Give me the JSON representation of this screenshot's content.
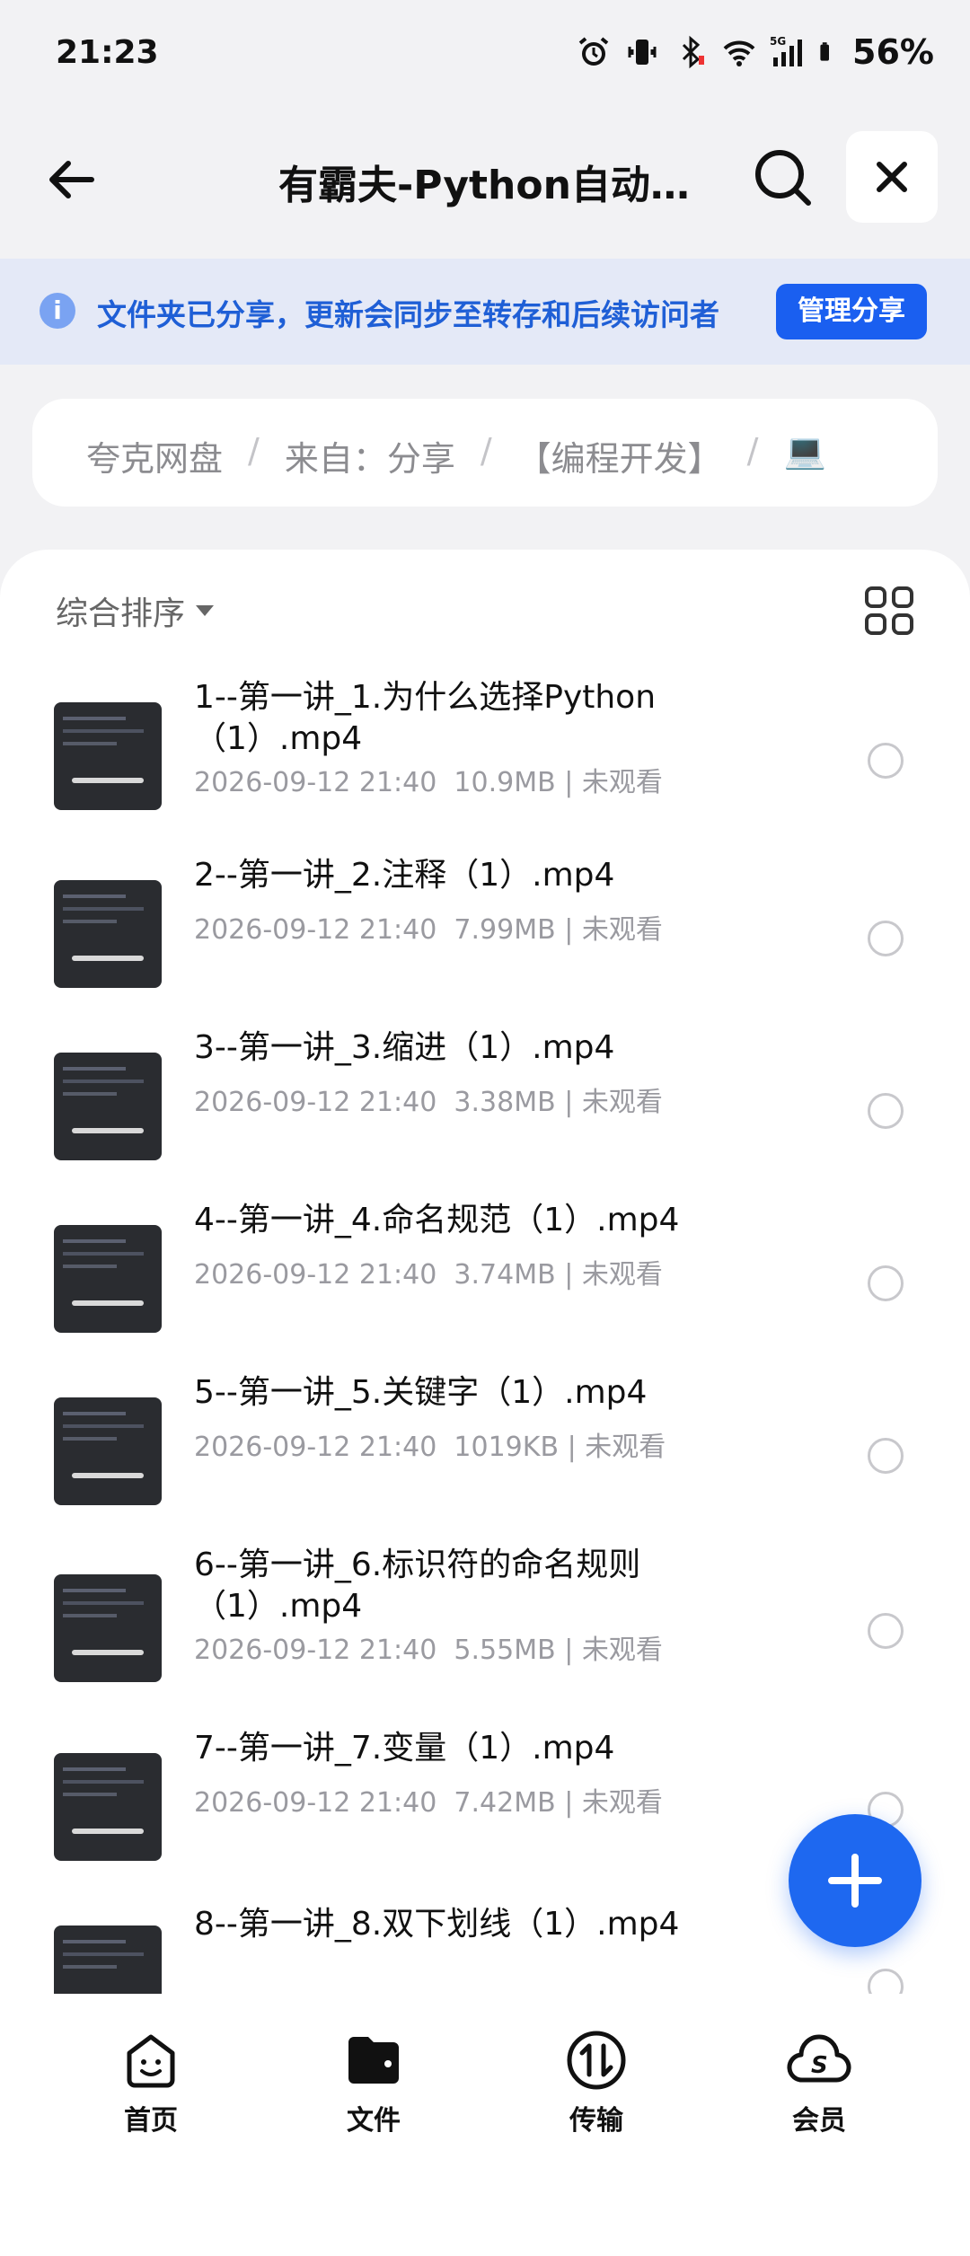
{
  "status": {
    "time": "21:23",
    "battery": "56%",
    "network": "5G",
    "icons": [
      "alarm-icon",
      "vibrate-icon",
      "bluetooth-icon",
      "wifi-icon",
      "signal-icon",
      "battery-icon"
    ]
  },
  "header": {
    "title": "有霸夫-Python自动...",
    "icons": [
      "back-arrow-icon",
      "search-icon",
      "close-icon"
    ]
  },
  "banner": {
    "text": "文件夹已分享，更新会同步至转存和后续访问者",
    "button": "管理分享"
  },
  "breadcrumb": {
    "items": [
      "夸克网盘",
      "来自：分享",
      "【编程开发】",
      "💻"
    ],
    "separator": "/"
  },
  "toolbar": {
    "sort_label": "综合排序"
  },
  "files": [
    {
      "name": "1--第一讲_1.为什么选择Python（1）.mp4",
      "date": "2026-09-12 21:40",
      "size": "10.9MB",
      "status": "未观看"
    },
    {
      "name": "2--第一讲_2.注释（1）.mp4",
      "date": "2026-09-12 21:40",
      "size": "7.99MB",
      "status": "未观看"
    },
    {
      "name": "3--第一讲_3.缩进（1）.mp4",
      "date": "2026-09-12 21:40",
      "size": "3.38MB",
      "status": "未观看"
    },
    {
      "name": "4--第一讲_4.命名规范（1）.mp4",
      "date": "2026-09-12 21:40",
      "size": "3.74MB",
      "status": "未观看"
    },
    {
      "name": "5--第一讲_5.关键字（1）.mp4",
      "date": "2026-09-12 21:40",
      "size": "1019KB",
      "status": "未观看"
    },
    {
      "name": "6--第一讲_6.标识符的命名规则（1）.mp4",
      "date": "2026-09-12 21:40",
      "size": "5.55MB",
      "status": "未观看"
    },
    {
      "name": "7--第一讲_7.变量（1）.mp4",
      "date": "2026-09-12 21:40",
      "size": "7.42MB",
      "status": "未观看"
    },
    {
      "name": "8--第一讲_8.双下划线（1）.mp4",
      "date": "",
      "size": "",
      "status": ""
    }
  ],
  "tabs": [
    {
      "label": "首页",
      "icon": "home-icon"
    },
    {
      "label": "文件",
      "icon": "folder-icon"
    },
    {
      "label": "传输",
      "icon": "transfer-icon"
    },
    {
      "label": "会员",
      "icon": "member-icon"
    }
  ],
  "colors": {
    "accent": "#1a5ff0",
    "banner_bg": "#e4e9f7",
    "banner_text": "#1f5fd6"
  }
}
